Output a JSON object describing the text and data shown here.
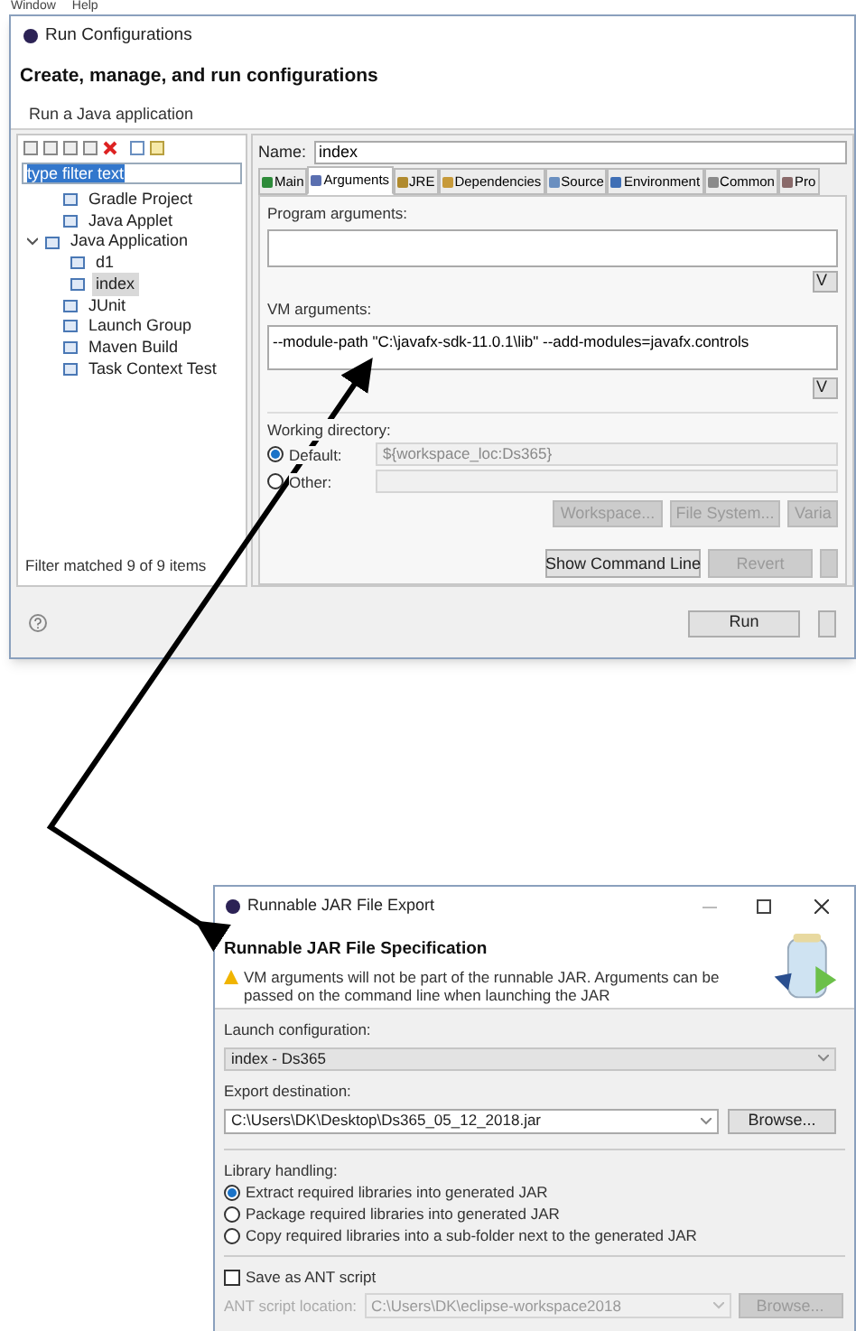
{
  "menu_bar": [
    "Window",
    "Help"
  ],
  "run_dialog": {
    "title": "Run Configurations",
    "heading": "Create, manage, and run configurations",
    "subtitle": "Run a Java application",
    "filter": {
      "value": "type filter text"
    },
    "tree": [
      {
        "label": "Gradle Project",
        "selected": false
      },
      {
        "label": "Java Applet",
        "selected": false
      },
      {
        "label": "Java Application",
        "selected": false,
        "expanded": true,
        "children": [
          {
            "label": "d1",
            "selected": false
          },
          {
            "label": "index",
            "selected": true
          }
        ]
      },
      {
        "label": "JUnit",
        "selected": false
      },
      {
        "label": "Launch Group",
        "selected": false
      },
      {
        "label": "Maven Build",
        "selected": false
      },
      {
        "label": "Task Context Test",
        "selected": false
      }
    ],
    "filter_status": "Filter matched 9 of 9 items",
    "name_label": "Name:",
    "name_value": "index",
    "tabs": [
      {
        "label": "Main",
        "selected": false
      },
      {
        "label": "Arguments",
        "selected": true
      },
      {
        "label": "JRE",
        "selected": false
      },
      {
        "label": "Dependencies",
        "selected": false
      },
      {
        "label": "Source",
        "selected": false
      },
      {
        "label": "Environment",
        "selected": false
      },
      {
        "label": "Common",
        "selected": false
      },
      {
        "label": "Pro",
        "selected": false
      }
    ],
    "program_arguments_label": "Program arguments:",
    "program_variables_button": "V",
    "vm_arguments_label": "VM arguments:",
    "vm_arguments": "--module-path \"C:\\javafx-sdk-11.0.1\\lib\" --add-modules=javafx.controls",
    "vm_variables_button": "V",
    "working_directory": {
      "label": "Working directory:",
      "options": [
        {
          "label": "Default:",
          "selected": true,
          "value": "${workspace_loc:Ds365}"
        },
        {
          "label": "Other:",
          "selected": false
        }
      ],
      "buttons": [
        {
          "label": "Workspace...",
          "disabled": true
        },
        {
          "label": "File System...",
          "disabled": true
        },
        {
          "label": "Varia",
          "disabled": true
        }
      ]
    },
    "action_buttons": [
      {
        "label": "Show Command Line",
        "disabled": false
      },
      {
        "label": "Revert",
        "disabled": true
      }
    ],
    "run_button": "Run"
  },
  "jar_dialog": {
    "title": "Runnable JAR File Export",
    "heading": "Runnable JAR File Specification",
    "warning": "VM arguments will not be part of the runnable JAR. Arguments can be passed on the command line when launching the JAR",
    "launch_configuration_label": "Launch configuration:",
    "launch_configuration": "index - Ds365",
    "export_destination_label": "Export destination:",
    "export_destination": "C:\\Users\\DK\\Desktop\\Ds365_05_12_2018.jar",
    "browse_button": "Browse...",
    "library_handling_label": "Library handling:",
    "library_options": [
      {
        "label": "Extract required libraries into generated JAR",
        "selected": true
      },
      {
        "label": "Package required libraries into generated JAR",
        "selected": false
      },
      {
        "label": "Copy required libraries into a sub-folder next to the generated JAR",
        "selected": false
      }
    ],
    "save_ant_script": {
      "label": "Save as ANT script",
      "checked": false
    },
    "ant_location_label": "ANT script location:",
    "ant_location": "C:\\Users\\DK\\eclipse-workspace2018",
    "ant_browse_button": {
      "label": "Browse...",
      "disabled": true
    }
  }
}
